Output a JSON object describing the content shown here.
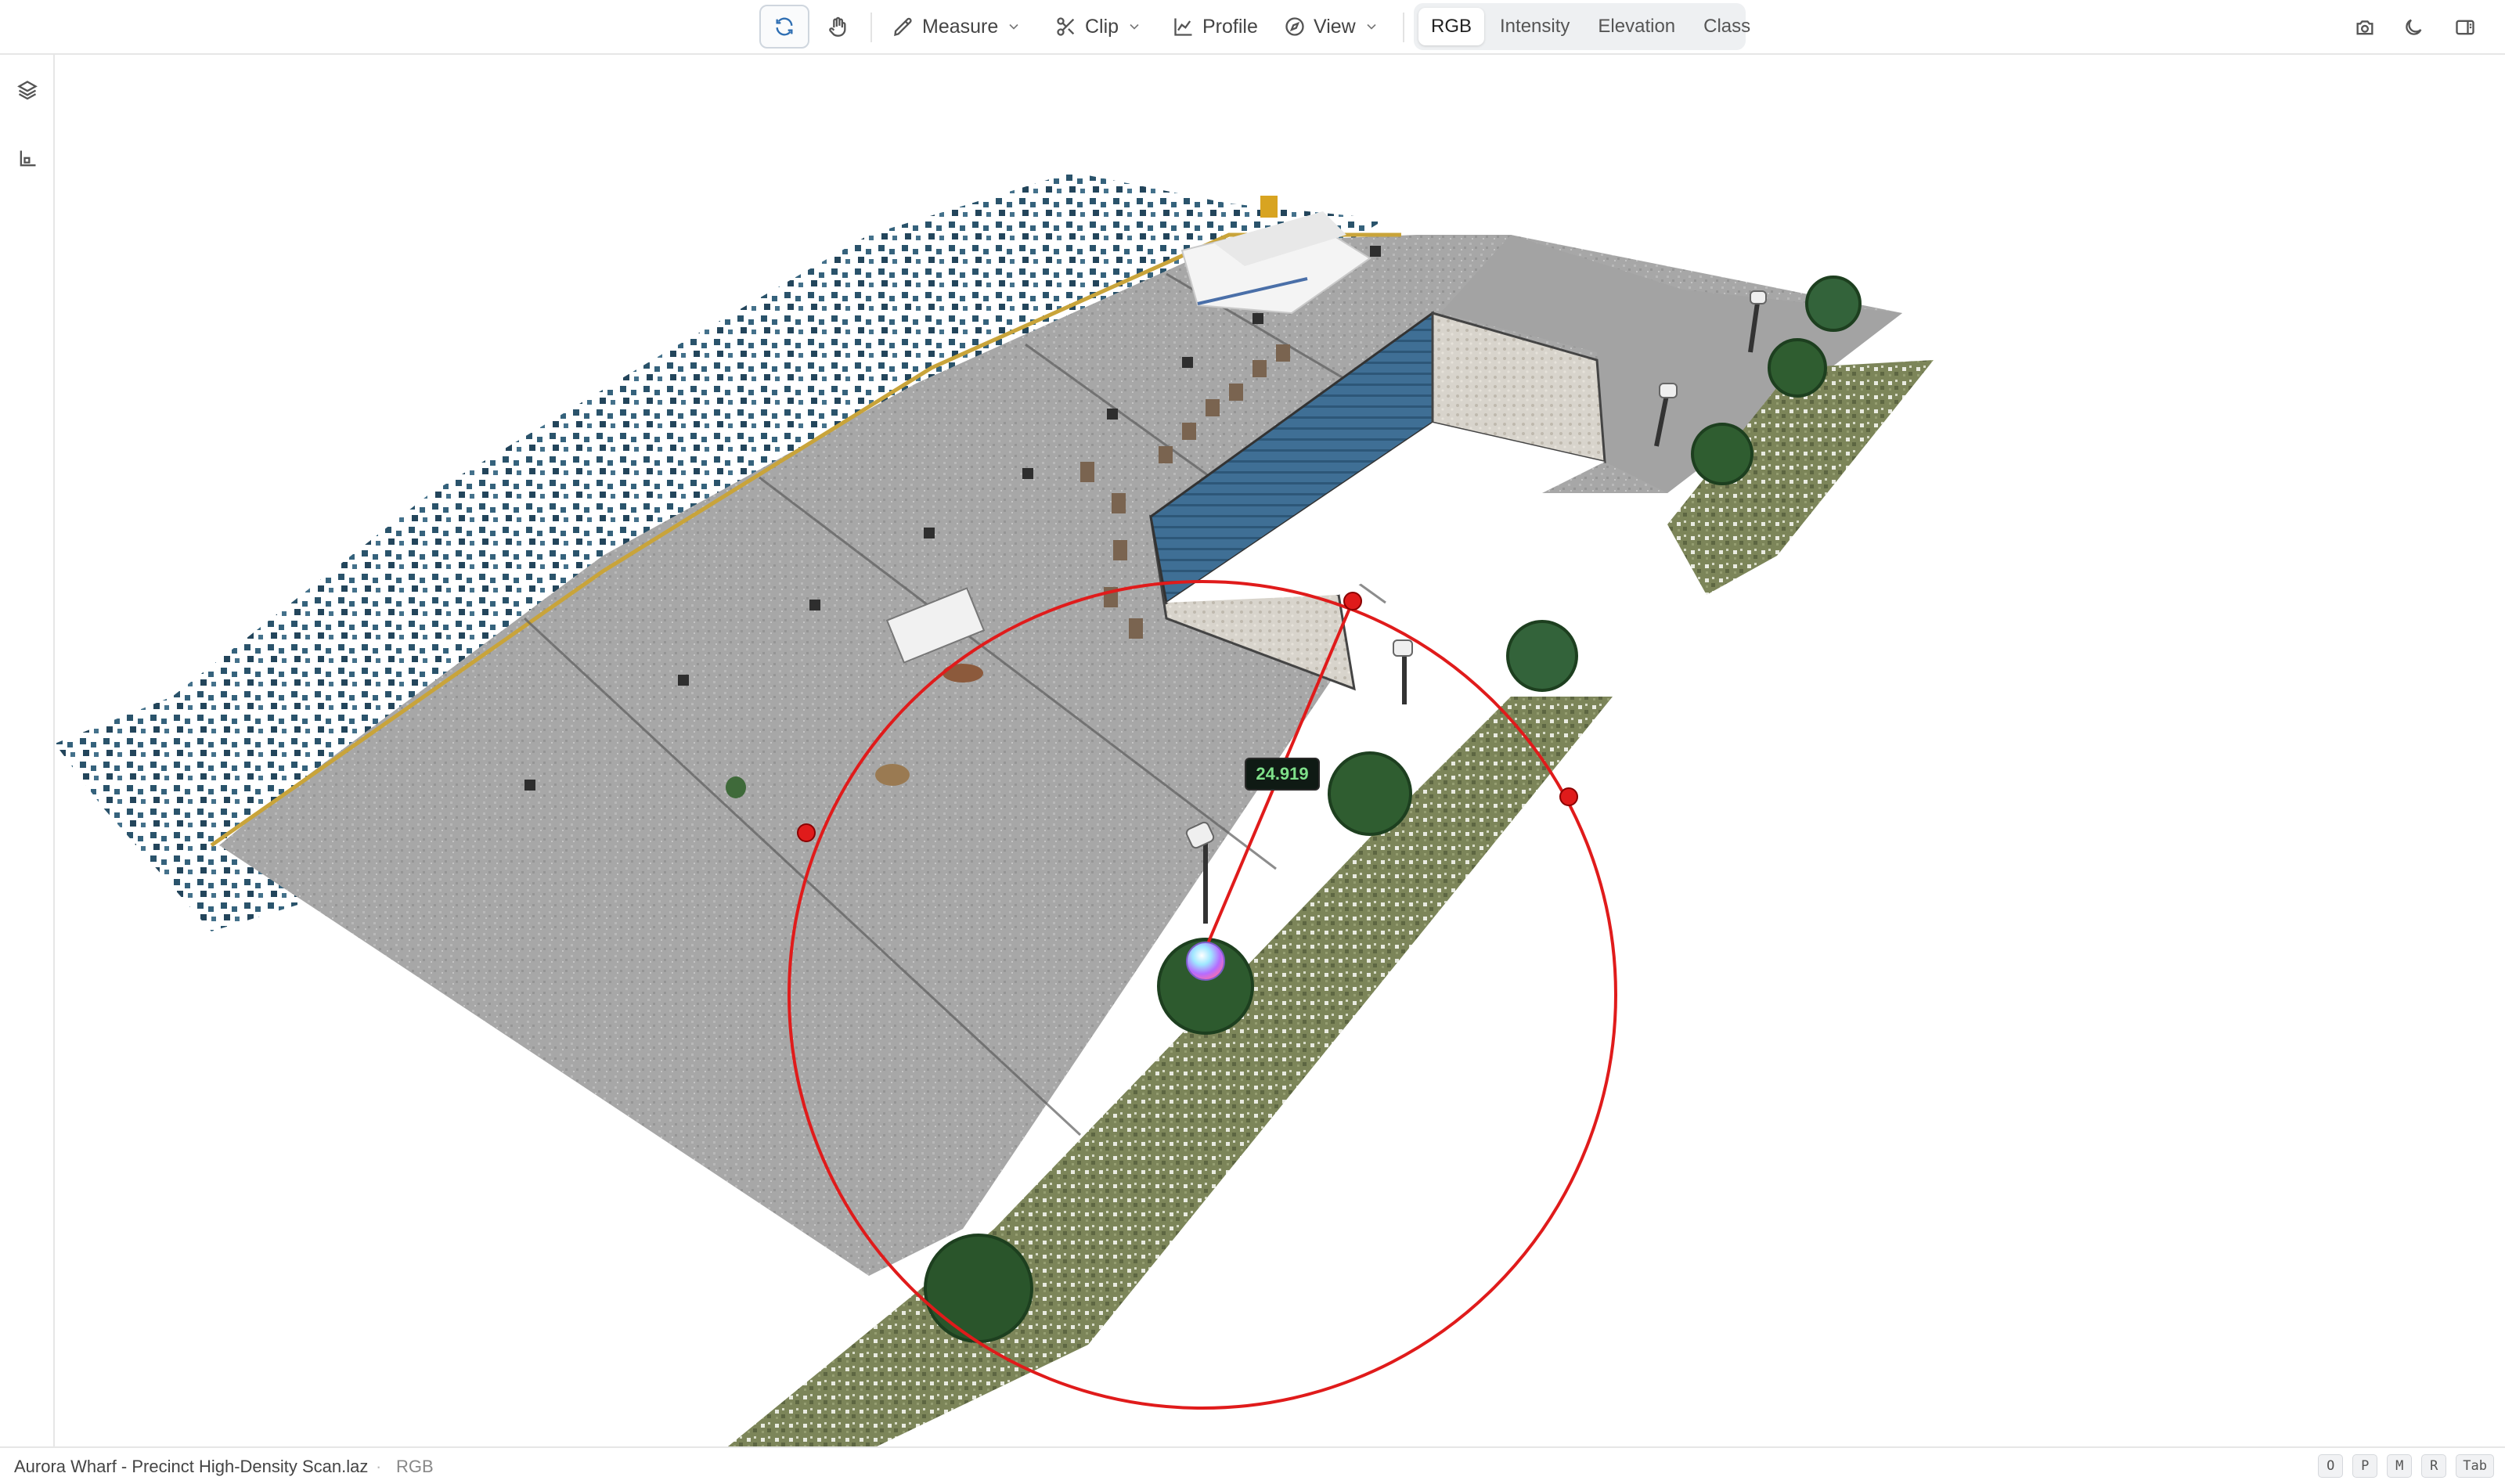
{
  "toolbar": {
    "measure_label": "Measure",
    "clip_label": "Clip",
    "profile_label": "Profile",
    "view_label": "View",
    "color_modes": [
      "RGB",
      "Intensity",
      "Elevation",
      "Class"
    ],
    "active_color_mode": "RGB"
  },
  "measurement": {
    "radius_label": "24.919"
  },
  "status": {
    "file_name": "Aurora Wharf - Precinct High-Density Scan.laz",
    "separator": "·",
    "color_mode": "RGB",
    "shortcut_keys": [
      "O",
      "P",
      "M",
      "R",
      "Tab"
    ]
  },
  "colors": {
    "measure_circle": "#e01b1b",
    "measure_label_text": "#7fe08a",
    "water": "#1f4a63",
    "pavement": "#a9a9a9",
    "grass": "#6f7a4e",
    "tree": "#2d5a2e"
  },
  "icons": {
    "orbit": "orbit-icon",
    "pan": "hand-icon",
    "measure": "ruler-icon",
    "clip": "scissors-icon",
    "profile": "profile-chart-icon",
    "view": "compass-icon",
    "screenshot": "camera-icon",
    "theme": "moon-icon",
    "panel": "panel-toggle-icon",
    "layers": "layers-icon",
    "axes": "axes-icon"
  }
}
